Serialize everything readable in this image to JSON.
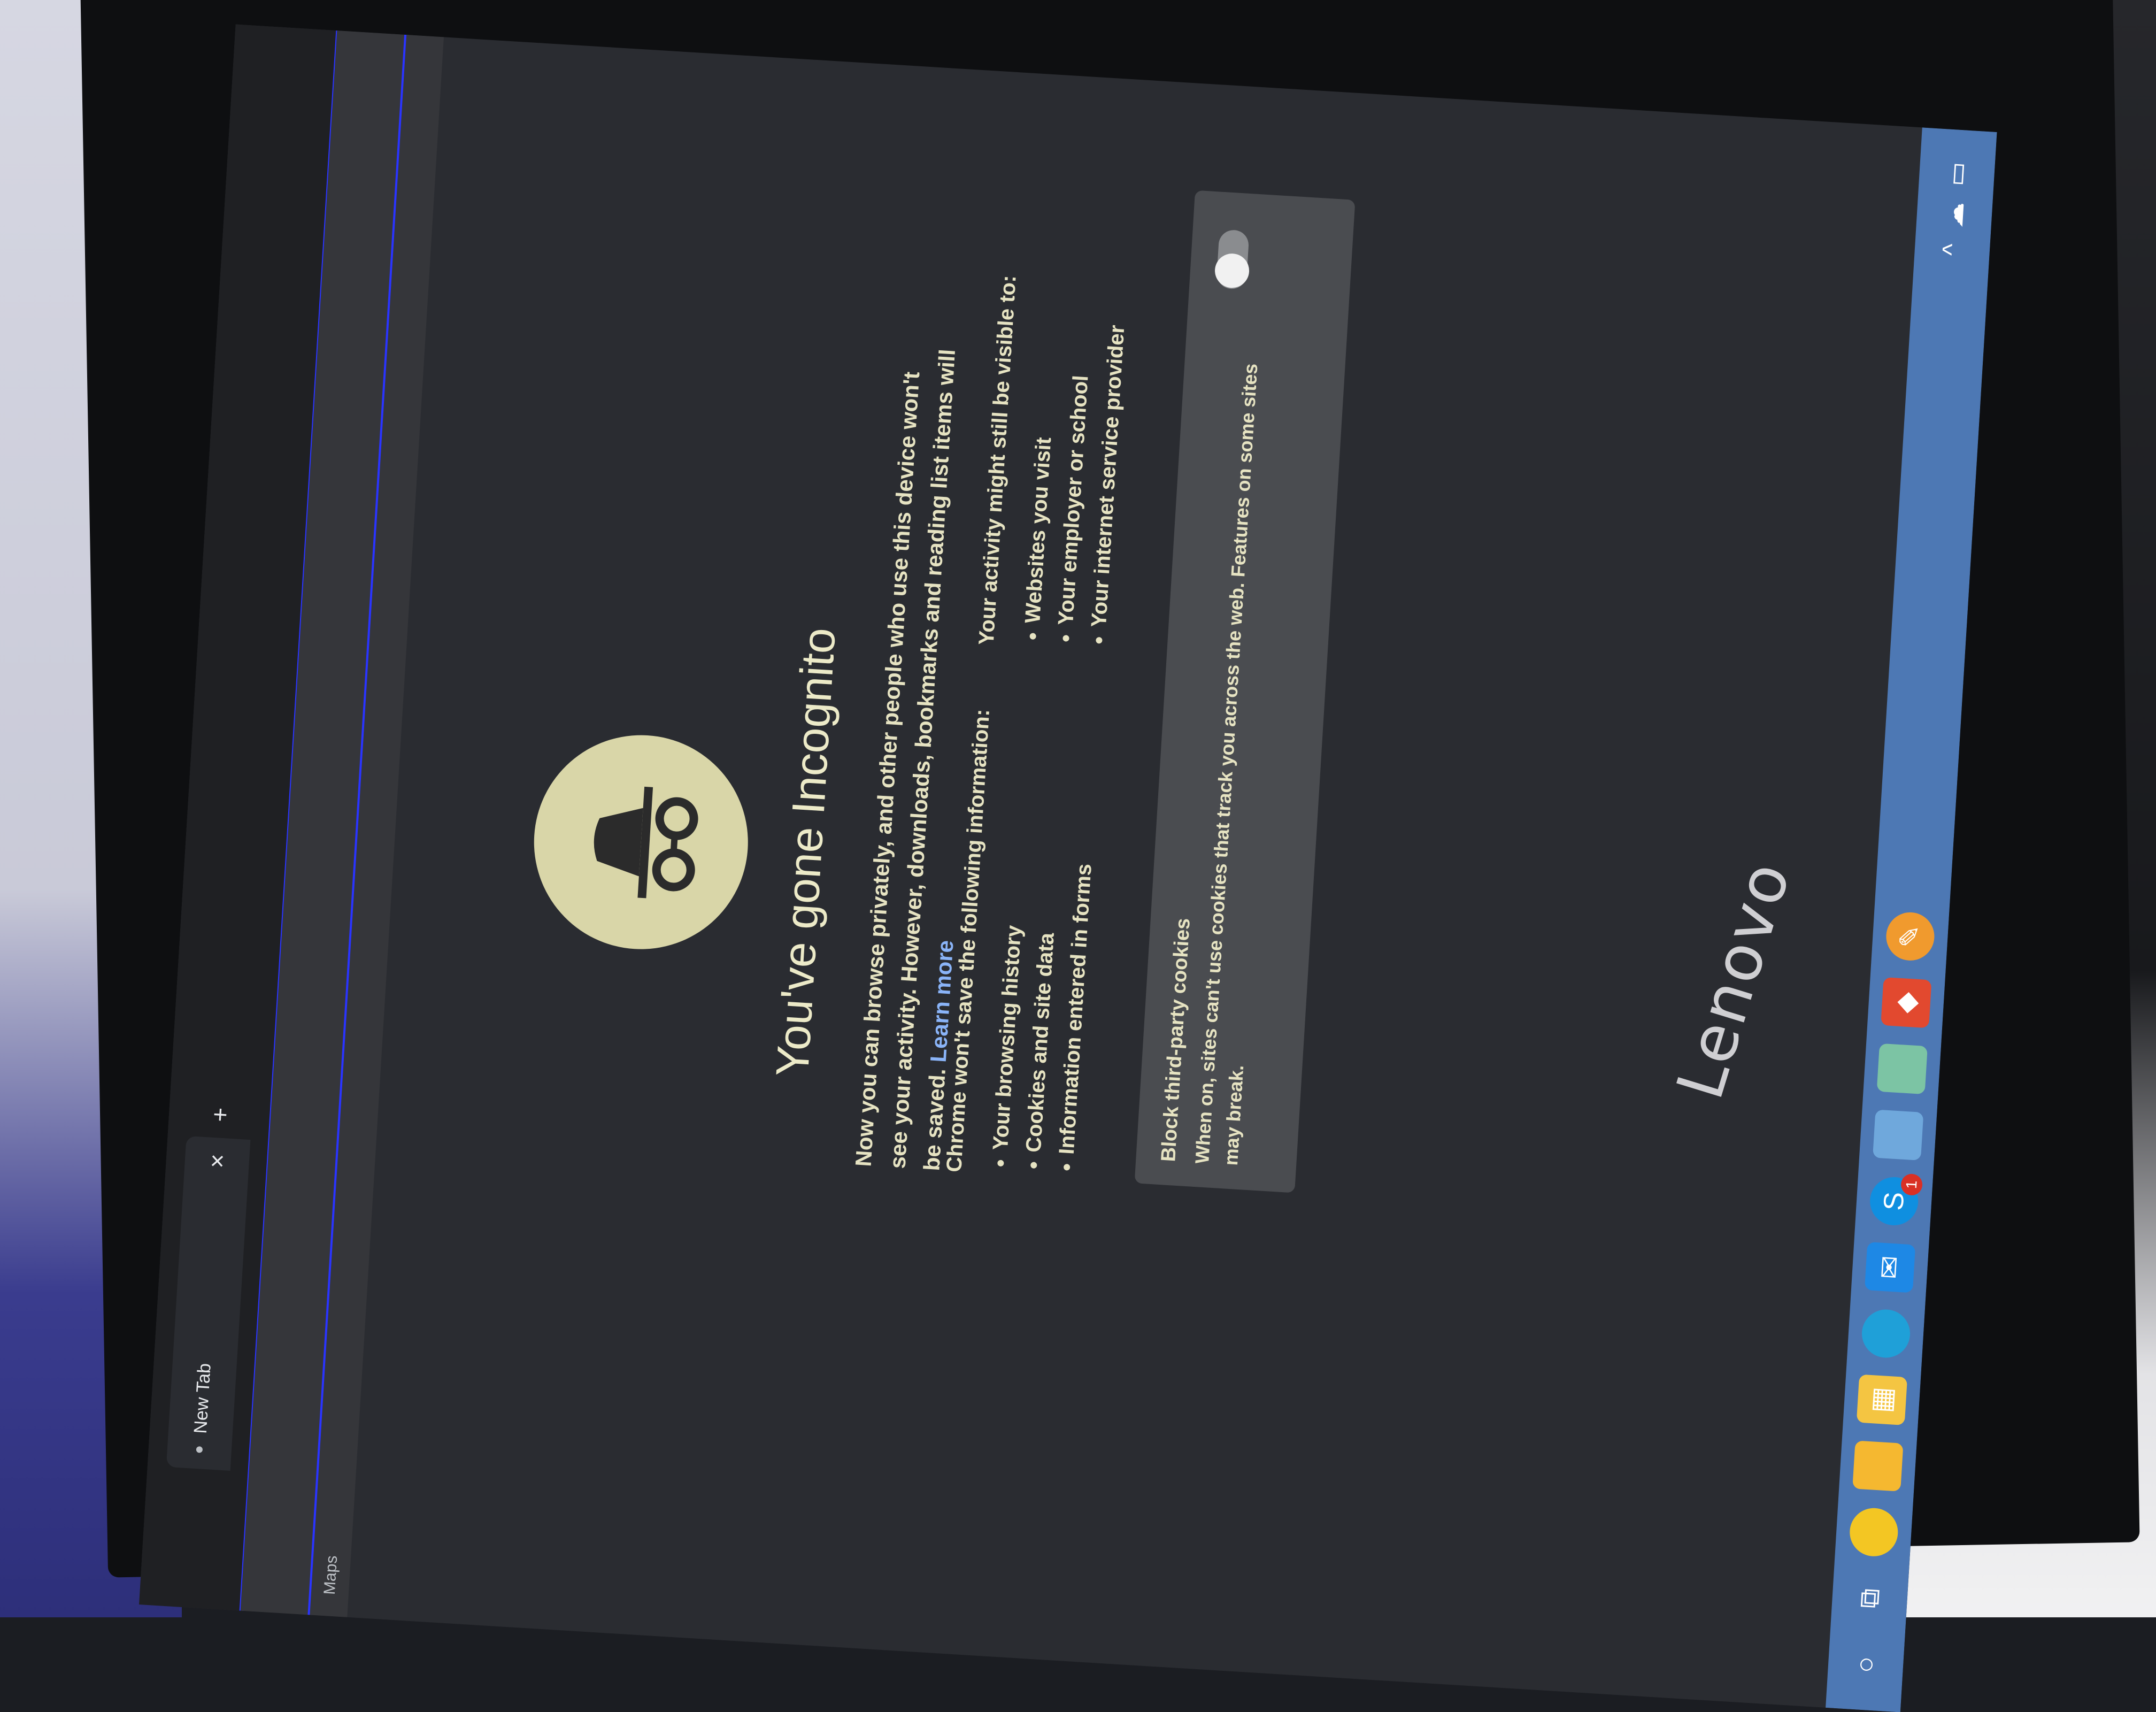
{
  "browser": {
    "tab_title": "New Tab",
    "tab_close_symbol": "×",
    "new_tab_symbol": "+",
    "bookmark_partial": "Maps"
  },
  "incognito": {
    "heading": "You've gone Incognito",
    "intro_text": "Now you can browse privately, and other people who use this device won't see your activity. However, downloads, bookmarks and reading list items will be saved.",
    "learn_more": "Learn more",
    "not_saved_title": "Chrome won't save the following information:",
    "not_saved_items": [
      "Your browsing history",
      "Cookies and site data",
      "Information entered in forms"
    ],
    "visible_title": "Your activity might still be visible to:",
    "visible_items": [
      "Websites you visit",
      "Your employer or school",
      "Your internet service provider"
    ],
    "cookies_title": "Block third-party cookies",
    "cookies_desc": "When on, sites can't use cookies that track you across the web. Features on some sites may break.",
    "cookies_toggle_on": false
  },
  "taskbar": {
    "icons": [
      "search-circle-icon",
      "task-view-icon",
      "chat-icon",
      "file-explorer-icon",
      "microsoft-store-icon",
      "edge-icon",
      "mail-icon",
      "skype-icon",
      "chrome-icon",
      "app-icon",
      "anydesk-icon",
      "pen-app-icon"
    ],
    "skype_badge": "1"
  },
  "monitor": {
    "brand": "Lenovo"
  },
  "colors": {
    "accent_link": "#8ab4f8",
    "text_cream": "#e6e3c2",
    "taskbar_blue": "#4d78b4",
    "tab_highlight": "#2a34ff"
  }
}
